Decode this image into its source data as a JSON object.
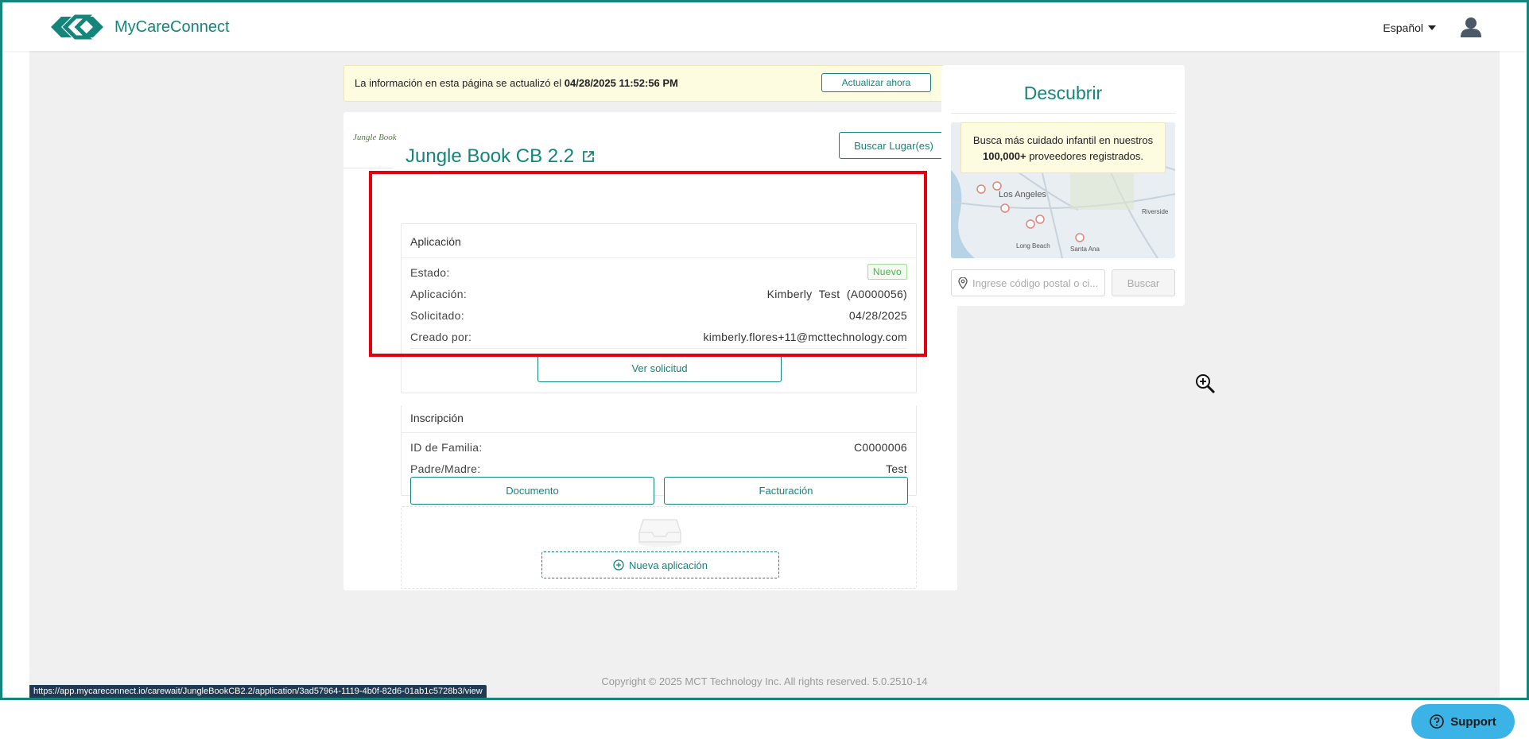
{
  "header": {
    "brand": "MyCareConnect",
    "language": "Español"
  },
  "banner": {
    "text_prefix": "La información en esta página se actualizó el ",
    "timestamp": "04/28/2025 11:52:56 PM",
    "refresh_label": "Actualizar ahora"
  },
  "provider": {
    "logo_text": "Jungle Book",
    "name": "Jungle Book CB 2.2",
    "find_button": "Buscar Lugar(es)"
  },
  "application": {
    "heading": "Aplicación",
    "status_label": "Estado:",
    "status_value": "Nuevo",
    "app_label": "Aplicación:",
    "app_value": "Kimberly  Test  (A0000056)",
    "requested_label": "Solicitado:",
    "requested_value": "04/28/2025",
    "created_label": "Creado por:",
    "created_value": "kimberly.flores+11@mcttechnology.com",
    "view_button": "Ver solicitud"
  },
  "enrollment": {
    "heading": "Inscripción",
    "family_label": "ID de Familia:",
    "family_value": "C0000006",
    "parent_label": "Padre/Madre:",
    "parent_value": "Test",
    "document_button": "Documento",
    "billing_button": "Facturación"
  },
  "new_application": {
    "button": "Nueva aplicación"
  },
  "discover": {
    "title": "Descubrir",
    "tooltip_line1": "Busca más cuidado infantil en nuestros",
    "tooltip_bold": "100,000+",
    "tooltip_line2": " proveedores registrados.",
    "map_labels": [
      "Los Angeles",
      "Long Beach",
      "Santa Ana",
      "Riverside"
    ],
    "search_placeholder": "Ingrese código postal o ci...",
    "search_button": "Buscar"
  },
  "footer": {
    "copyright": "Copyright © 2025 MCT Technology Inc. All rights reserved. 5.0.2510-14"
  },
  "status_bar": {
    "url": "https://app.mycareconnect.io/carewait/JungleBookCB2.2/application/3ad57964-1119-4b0f-82d6-01ab1c5728b3/view"
  },
  "support": {
    "label": "Support"
  },
  "colors": {
    "brand": "#14857a",
    "highlight": "#e3000f",
    "banner_bg": "#fdfbe0",
    "support_bg": "#3bb3e6"
  }
}
